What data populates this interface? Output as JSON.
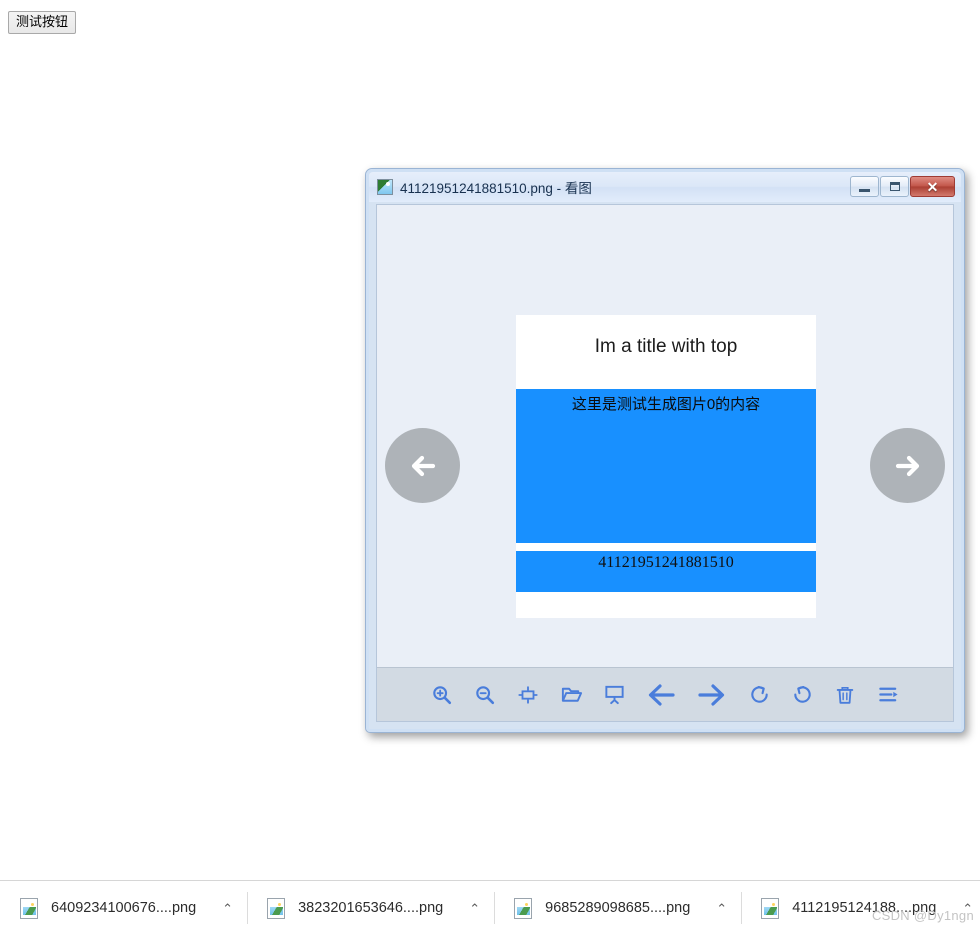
{
  "page": {
    "test_button_label": "测试按钮"
  },
  "viewer": {
    "title": "41121951241881510.png - 看图",
    "title_icon": "image-file-icon",
    "window_controls": {
      "minimize": "minimize-icon",
      "maximize": "maximize-icon",
      "close": "✕"
    },
    "nav": {
      "prev": "arrow-left-icon",
      "next": "arrow-right-icon"
    },
    "image": {
      "title": "Im a title with top",
      "content": "这里是测试生成图片0的内容",
      "footer": "41121951241881510",
      "accent_color": "#1890ff",
      "background_color": "#ffffff"
    },
    "toolbar": {
      "items": [
        {
          "name": "zoom-in-icon",
          "label": "放大"
        },
        {
          "name": "zoom-out-icon",
          "label": "缩小"
        },
        {
          "name": "fit-screen-icon",
          "label": "适应窗口"
        },
        {
          "name": "open-folder-icon",
          "label": "打开"
        },
        {
          "name": "slideshow-icon",
          "label": "幻灯片放映"
        },
        {
          "name": "previous-image-icon",
          "label": "上一张"
        },
        {
          "name": "next-image-icon",
          "label": "下一张"
        },
        {
          "name": "rotate-clockwise-icon",
          "label": "顺时针旋转"
        },
        {
          "name": "rotate-counterclockwise-icon",
          "label": "逆时针旋转"
        },
        {
          "name": "delete-icon",
          "label": "删除"
        },
        {
          "name": "more-options-icon",
          "label": "更多"
        }
      ]
    }
  },
  "downloads": {
    "items": [
      {
        "filename": "6409234100676....png",
        "caret": "⌃"
      },
      {
        "filename": "3823201653646....png",
        "caret": "⌃"
      },
      {
        "filename": "9685289098685....png",
        "caret": "⌃"
      },
      {
        "filename": "4112195124188....png",
        "caret": "⌃"
      }
    ]
  },
  "watermark": "CSDN @Dy1ngn"
}
